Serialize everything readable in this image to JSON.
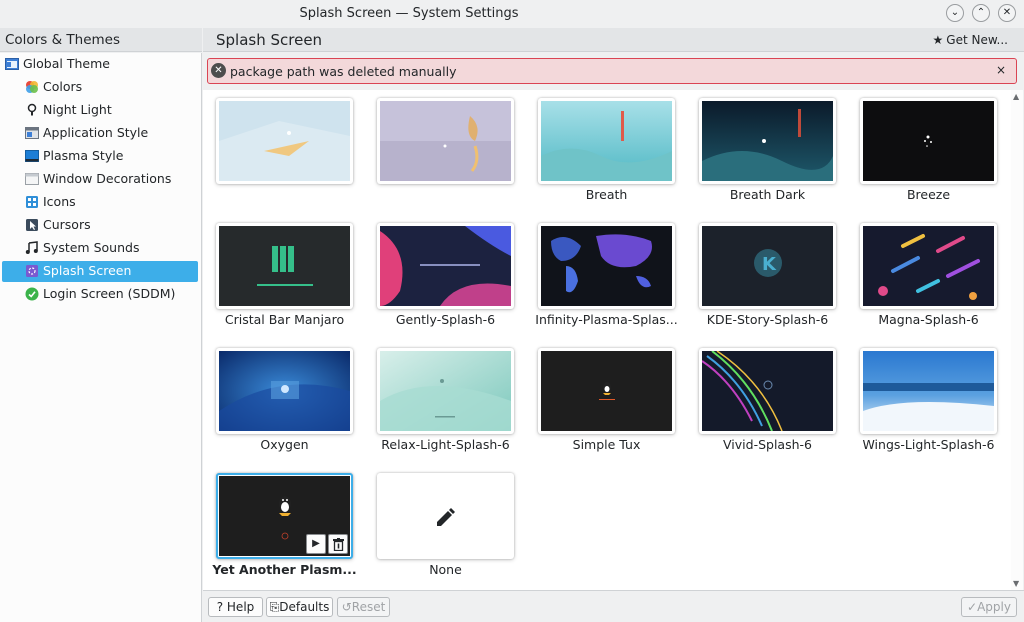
{
  "window": {
    "title": "Splash Screen — System Settings"
  },
  "sidebar": {
    "header": "Colors & Themes",
    "items": [
      {
        "label": "Global Theme",
        "icon": "global-theme-icon"
      },
      {
        "label": "Colors",
        "icon": "colors-icon"
      },
      {
        "label": "Night Light",
        "icon": "night-light-icon"
      },
      {
        "label": "Application Style",
        "icon": "application-style-icon"
      },
      {
        "label": "Plasma Style",
        "icon": "plasma-style-icon"
      },
      {
        "label": "Window Decorations",
        "icon": "window-decorations-icon"
      },
      {
        "label": "Icons",
        "icon": "icons-icon"
      },
      {
        "label": "Cursors",
        "icon": "cursors-icon"
      },
      {
        "label": "System Sounds",
        "icon": "system-sounds-icon"
      },
      {
        "label": "Splash Screen",
        "icon": "splash-screen-icon",
        "active": true
      },
      {
        "label": "Login Screen (SDDM)",
        "icon": "login-screen-icon"
      }
    ]
  },
  "main": {
    "title": "Splash Screen",
    "get_new": "Get New...",
    "banner": {
      "message": "package path was deleted manually",
      "close": "×"
    }
  },
  "themes": [
    {
      "name": ""
    },
    {
      "name": ""
    },
    {
      "name": "Breath"
    },
    {
      "name": "Breath Dark"
    },
    {
      "name": "Breeze"
    },
    {
      "name": "Cristal Bar Manjaro"
    },
    {
      "name": "Gently-Splash-6"
    },
    {
      "name": "Infinity-Plasma-Splas..."
    },
    {
      "name": "KDE-Story-Splash-6"
    },
    {
      "name": "Magna-Splash-6"
    },
    {
      "name": "Oxygen"
    },
    {
      "name": "Relax-Light-Splash-6"
    },
    {
      "name": "Simple Tux"
    },
    {
      "name": "Vivid-Splash-6"
    },
    {
      "name": "Wings-Light-Splash-6"
    },
    {
      "name": "Yet Another Plasm...",
      "selected": true
    },
    {
      "name": "None"
    }
  ],
  "footer": {
    "help": "Help",
    "defaults": "Defaults",
    "reset": "Reset",
    "apply": "Apply"
  },
  "colors": {
    "accent": "#3daee9",
    "error_border": "#da4453",
    "error_bg": "#f3d8da"
  }
}
